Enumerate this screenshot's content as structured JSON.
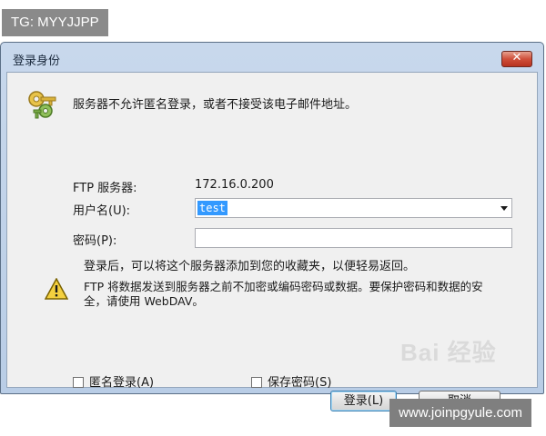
{
  "overlay": {
    "top_tag": "TG: MYYJJPP",
    "bottom_tag": "www.joinpgyule.com",
    "watermark": "Bai 经验"
  },
  "dialog": {
    "title": "登录身份",
    "close_label": "✕",
    "message": "服务器不允许匿名登录，或者不接受该电子邮件地址。",
    "ftp_server_label": "FTP 服务器:",
    "ftp_server_value": "172.16.0.200",
    "username_label": "用户名(U):",
    "username_value": "test",
    "password_label": "密码(P):",
    "password_value": "",
    "note_favorites": "登录后，可以将这个服务器添加到您的收藏夹，以便轻易返回。",
    "note_security": "FTP 将数据发送到服务器之前不加密或编码密码或数据。要保护密码和数据的安全，请使用 WebDAV。",
    "anonymous_label": "匿名登录(A)",
    "anonymous_checked": false,
    "save_password_label": "保存密码(S)",
    "save_password_checked": false,
    "login_button": "登录(L)",
    "cancel_button": "取消"
  },
  "icons": {
    "keys": "keys-icon",
    "warning": "warning-icon",
    "close": "close-icon",
    "dropdown": "chevron-down-icon"
  }
}
